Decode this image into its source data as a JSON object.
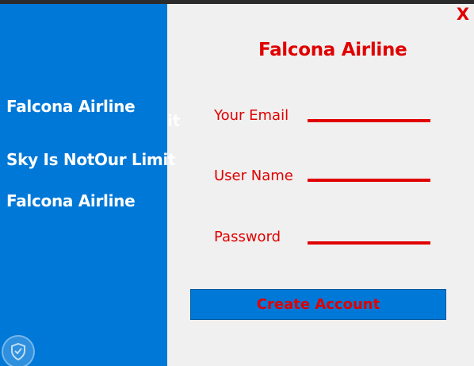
{
  "window": {
    "close_label": "X"
  },
  "sidebar": {
    "title": "Falcona Airline",
    "tagline": "Sky Is NotOur Limit",
    "title_repeat": "Falcona Airline",
    "overflow_fragment": "it"
  },
  "form": {
    "title": "Falcona Airline",
    "fields": {
      "email": {
        "label": "Your Email",
        "value": "",
        "placeholder": ""
      },
      "username": {
        "label": "User Name",
        "value": "",
        "placeholder": ""
      },
      "password": {
        "label": "Password",
        "value": "",
        "placeholder": ""
      }
    },
    "submit_label": "Create Account"
  },
  "colors": {
    "sidebar_bg": "#0078d7",
    "accent_red": "#e00000",
    "form_bg": "#f0f0f0",
    "button_bg": "#0078d7"
  },
  "icons": {
    "logo": "shield-check-icon"
  }
}
